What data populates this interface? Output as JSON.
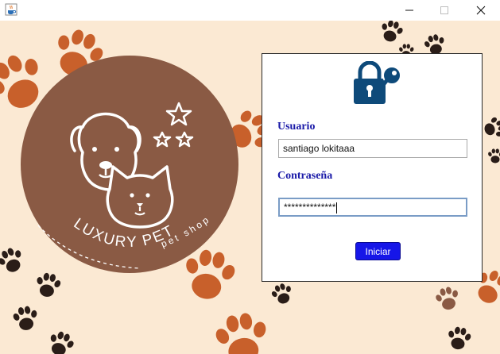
{
  "window": {
    "app_icon": "java-cup-icon",
    "controls": [
      "minimize-icon",
      "maximize-icon",
      "close-icon"
    ]
  },
  "brand": {
    "name": "LUXURY PET",
    "tagline": "pet shop"
  },
  "login": {
    "icon": "lock-and-key-icon",
    "username_label": "Usuario",
    "username_value": "santiago lokitaaa",
    "password_label": "Contraseña",
    "password_value": "**************",
    "submit_label": "Iniciar"
  },
  "colors": {
    "background": "#fbe9d3",
    "paw_orange": "#c8602b",
    "paw_dark": "#2a1d18",
    "paw_brown": "#8a5a44",
    "logo_circle": "#8a5a44",
    "label_blue": "#1a1aa8",
    "button_blue": "#1616e8",
    "lock_blue": "#0e4a7a"
  }
}
